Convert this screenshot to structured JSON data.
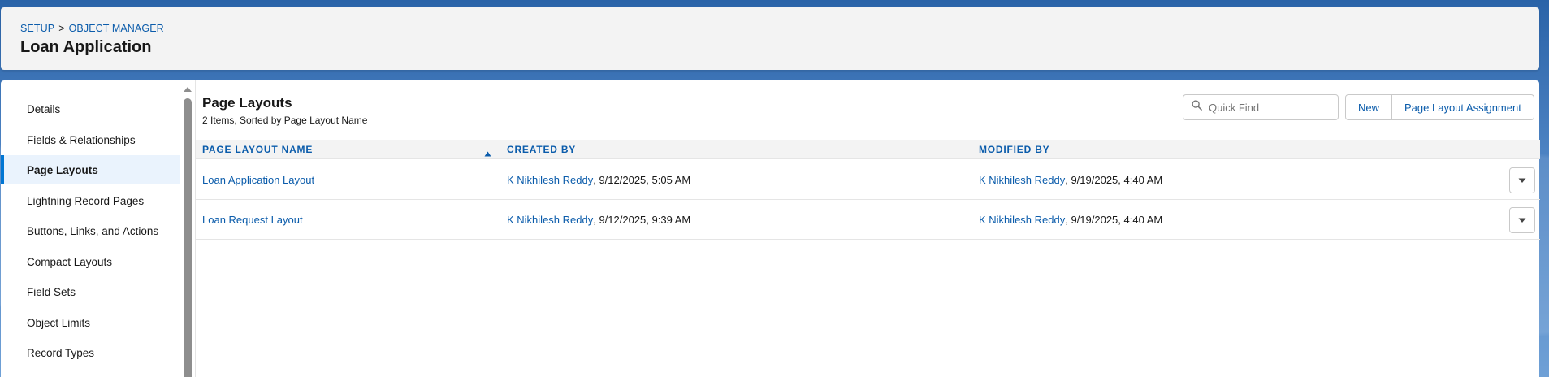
{
  "header": {
    "breadcrumb": [
      {
        "label": "SETUP"
      },
      {
        "label": "OBJECT MANAGER"
      }
    ],
    "breadcrumb_separator": ">",
    "title": "Loan Application"
  },
  "sidebar": {
    "items": [
      {
        "label": "Details",
        "active": false
      },
      {
        "label": "Fields & Relationships",
        "active": false
      },
      {
        "label": "Page Layouts",
        "active": true
      },
      {
        "label": "Lightning Record Pages",
        "active": false
      },
      {
        "label": "Buttons, Links, and Actions",
        "active": false
      },
      {
        "label": "Compact Layouts",
        "active": false
      },
      {
        "label": "Field Sets",
        "active": false
      },
      {
        "label": "Object Limits",
        "active": false
      },
      {
        "label": "Record Types",
        "active": false
      }
    ]
  },
  "main": {
    "title": "Page Layouts",
    "subtitle": "2 Items, Sorted by Page Layout Name",
    "search": {
      "placeholder": "Quick Find",
      "value": ""
    },
    "buttons": {
      "new": "New",
      "assignment": "Page Layout Assignment"
    },
    "columns": [
      "PAGE LAYOUT NAME",
      "CREATED BY",
      "MODIFIED BY"
    ],
    "sort": {
      "column": "PAGE LAYOUT NAME",
      "direction": "ascending"
    },
    "rows": [
      {
        "name": "Loan Application Layout",
        "created_by": "K Nikhilesh Reddy",
        "created_at": ", 9/12/2025, 5:05 AM",
        "modified_by": "K Nikhilesh Reddy",
        "modified_at": ", 9/19/2025, 4:40 AM"
      },
      {
        "name": "Loan Request Layout",
        "created_by": "K Nikhilesh Reddy",
        "created_at": ", 9/12/2025, 9:39 AM",
        "modified_by": "K Nikhilesh Reddy",
        "modified_at": ", 9/19/2025, 4:40 AM"
      }
    ]
  },
  "colors": {
    "brand_blue": "#0b5cab",
    "active_accent": "#0176d3",
    "active_bg": "#eaf3fd",
    "header_bg": "#f3f3f3"
  },
  "icons": {
    "search": "search-icon",
    "sort": "sort-ascending-icon",
    "row_menu": "chevron-down-icon",
    "scroll": "scroll-up-arrow-icon"
  }
}
